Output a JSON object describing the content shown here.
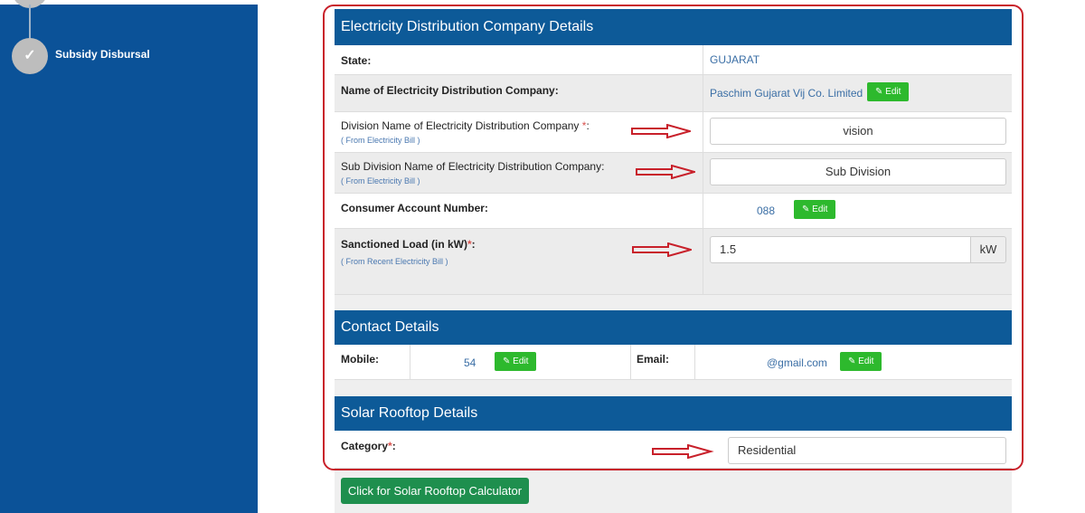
{
  "sidebar": {
    "step_label": "Subsidy Disbursal",
    "step_icon": "check-icon"
  },
  "electricity": {
    "title": "Electricity Distribution Company Details",
    "state_label": "State:",
    "state_value": "GUJARAT",
    "company_label": "Name of Electricity Distribution Company:",
    "company_value": "Paschim Gujarat Vij Co. Limited",
    "division_label": "Division Name of Electricity Distribution Company ",
    "division_note": "( From Electricity Bill )",
    "division_value": "vision",
    "subdivision_label": "Sub Division Name of Electricity Distribution Company:",
    "subdivision_note": "( From Electricity Bill )",
    "subdivision_value": "Sub Division",
    "consumer_label": "Consumer Account Number:",
    "consumer_value": "088",
    "load_label": "Sanctioned Load (in kW)",
    "load_note": "( From Recent Electricity Bill )",
    "load_value": "1.5",
    "load_unit": "kW"
  },
  "contact": {
    "title": "Contact Details",
    "mobile_label": "Mobile:",
    "mobile_value": "54",
    "email_label": "Email:",
    "email_value": "@gmail.com"
  },
  "solar": {
    "title": "Solar Rooftop Details",
    "category_label": "Category",
    "category_value": "Residential",
    "calculator_button": "Click for Solar Rooftop Calculator"
  },
  "common": {
    "edit_label": "Edit",
    "required": "*",
    "colon": ":"
  },
  "colors": {
    "sidebar": "#0b5298",
    "header": "#0d5a98",
    "edit": "#2db92d",
    "button": "#1e8f4e",
    "annotation": "#c8202a"
  }
}
